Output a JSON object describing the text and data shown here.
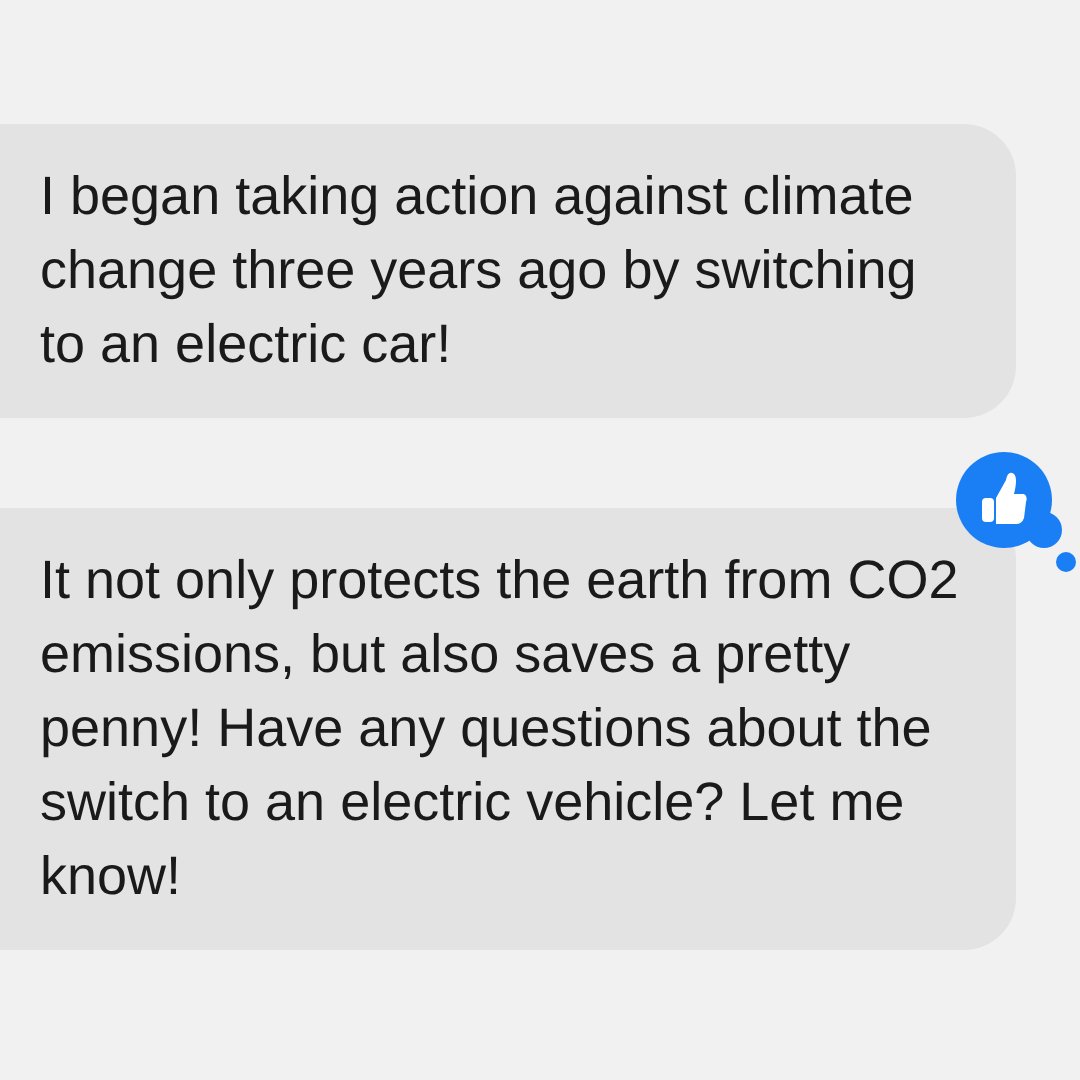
{
  "messages": [
    {
      "text": "I began taking action against climate change three years ago by switching to an electric car!",
      "liked": false
    },
    {
      "text": "It not only protects the earth from CO2 emissions, but also saves a pretty penny! Have any questions about the switch to an electric vehicle? Let me know!",
      "liked": true
    }
  ]
}
